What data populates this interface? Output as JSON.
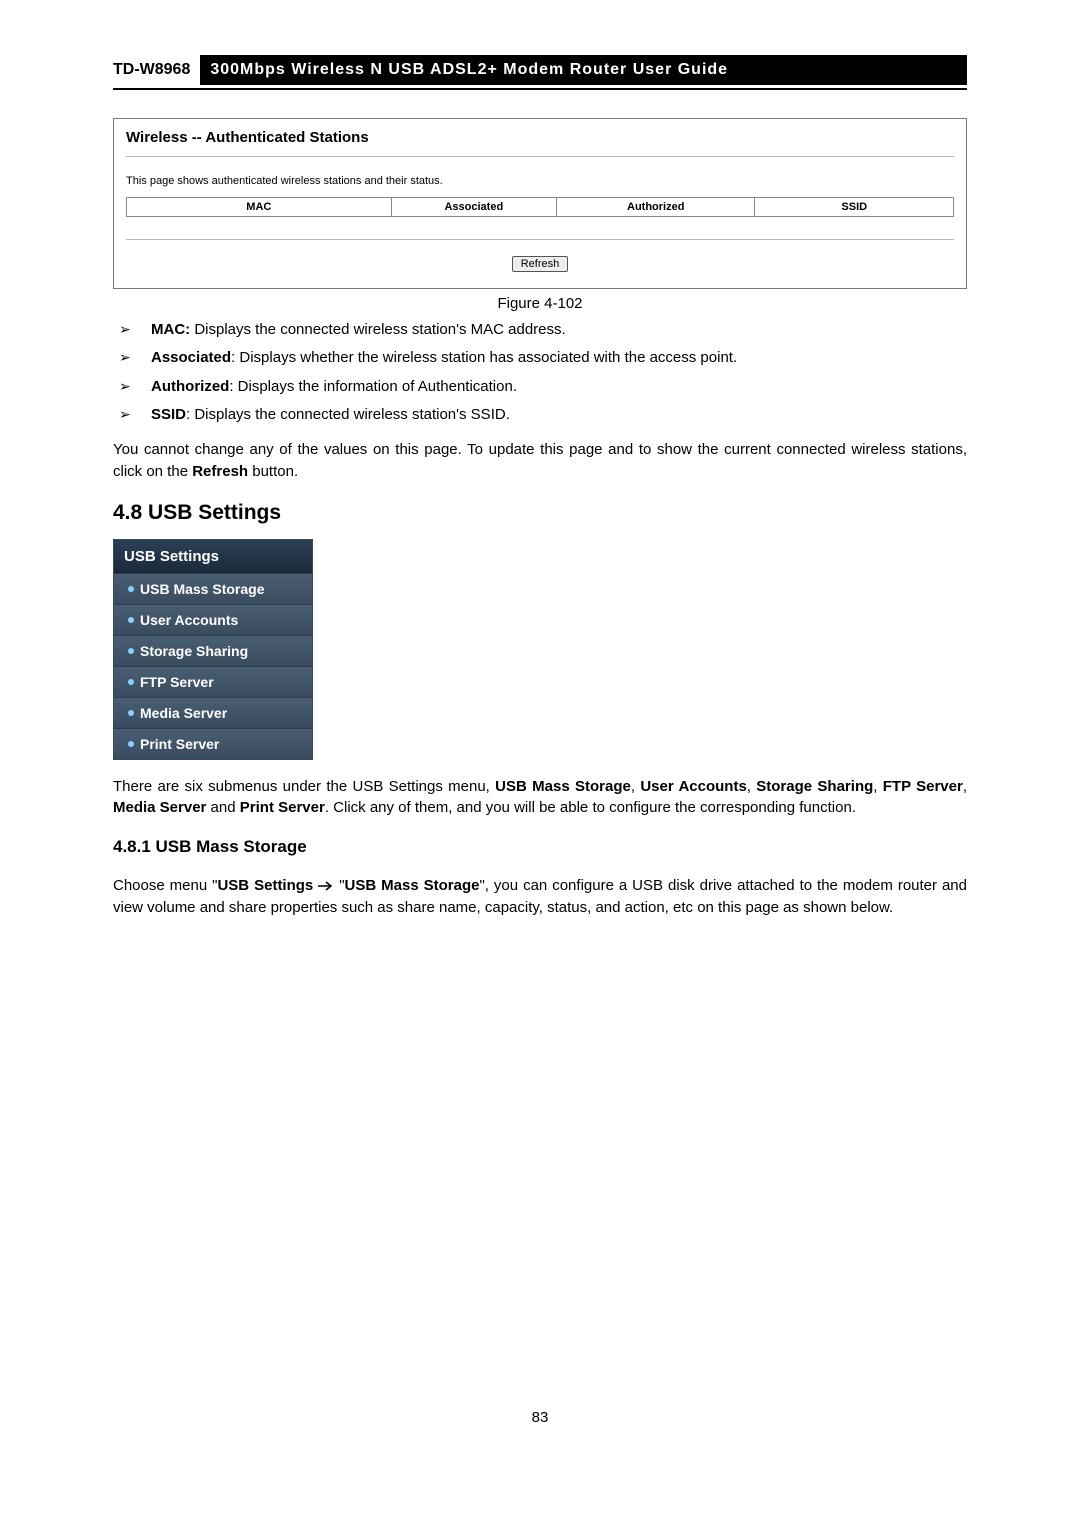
{
  "header": {
    "model": "TD-W8968",
    "title": "300Mbps Wireless N USB ADSL2+ Modem Router User Guide"
  },
  "panel": {
    "heading": "Wireless -- Authenticated Stations",
    "desc": "This page shows authenticated wireless stations and their status.",
    "cols": {
      "mac": "MAC",
      "associated": "Associated",
      "authorized": "Authorized",
      "ssid": "SSID"
    },
    "refresh": "Refresh"
  },
  "figure_caption": "Figure 4-102",
  "bullets": {
    "mac_label": "MAC:",
    "mac_text": " Displays the connected wireless station's MAC address.",
    "assoc_label": "Associated",
    "assoc_text": ": Displays whether the wireless station has associated with the access point.",
    "auth_label": "Authorized",
    "auth_text": ": Displays the information of Authentication.",
    "ssid_label": "SSID",
    "ssid_text": ": Displays the connected wireless station's SSID."
  },
  "para1_pre": "You cannot change any of the values on this page. To update this page and to show the current connected wireless stations, click on the ",
  "para1_b": "Refresh",
  "para1_post": " button.",
  "section_48": "4.8  USB Settings",
  "nav": {
    "header": "USB Settings",
    "items": [
      "USB Mass Storage",
      "User Accounts",
      "Storage Sharing",
      "FTP Server",
      "Media Server",
      "Print Server"
    ]
  },
  "para2": {
    "pre": "There are six submenus under the USB Settings menu, ",
    "b1": "USB Mass Storage",
    "s1": ", ",
    "b2": "User Accounts",
    "s2": ", ",
    "b3": "Storage Sharing",
    "s3": ", ",
    "b4": "FTP Server",
    "s4": ", ",
    "b5": "Media Server",
    "s5": " and ",
    "b6": "Print Server",
    "post": ". Click any of them, and you will be able to configure the corresponding function."
  },
  "sub_481": "4.8.1  USB Mass Storage",
  "para3": {
    "pre": "Choose menu \"",
    "b1": "USB Settings",
    "mid1": " ",
    "mid2": " \"",
    "b2": "USB Mass Storage",
    "post": "\", you can configure a USB disk drive attached to the modem router and view volume and share properties such as share name, capacity, status, and action, etc on this page as shown below."
  },
  "page_number": "83"
}
